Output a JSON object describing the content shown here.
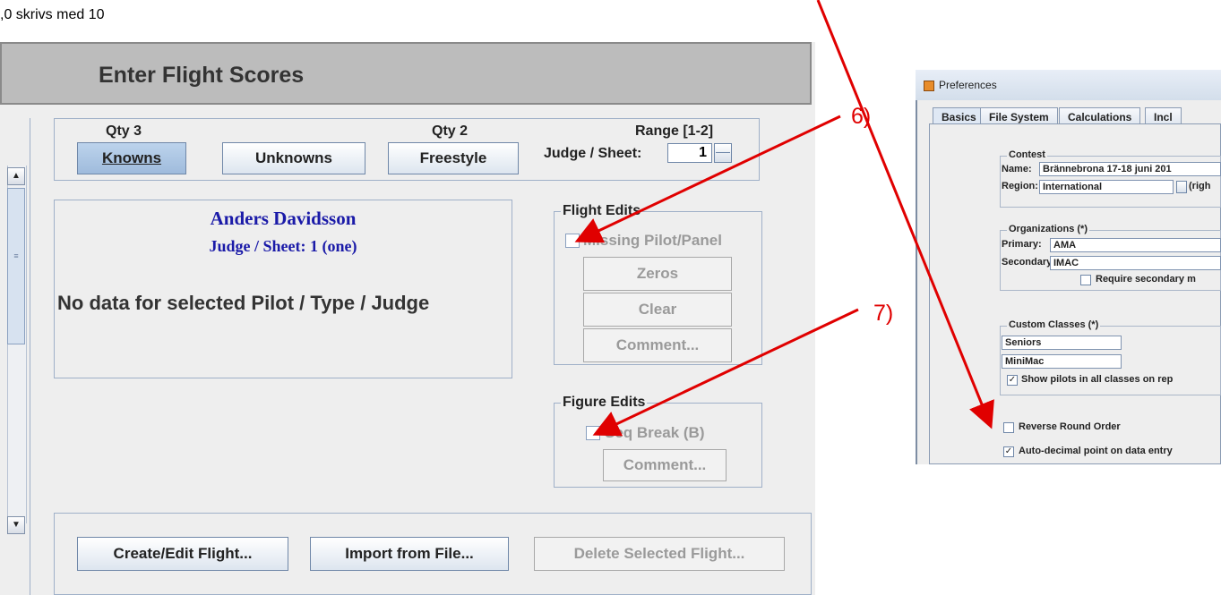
{
  "caption": ",0 skrivs med 10",
  "main": {
    "title": "Enter Flight Scores",
    "qty_knowns": "Qty 3",
    "qty_freestyle": "Qty 2",
    "range": "Range [1-2]",
    "btn_knowns": "Knowns",
    "btn_unknowns": "Unknowns",
    "btn_freestyle": "Freestyle",
    "judge_sheet_label": "Judge / Sheet:",
    "judge_sheet_value": "1",
    "pilot_name": "Anders Davidsson",
    "pilot_judge": "Judge / Sheet:  1 (one)",
    "no_data": "No data for selected Pilot / Type / Judge",
    "flight_edits_title": "Flight Edits",
    "missing_pilot": "Missing Pilot/Panel",
    "btn_zeros": "Zeros",
    "btn_clear": "Clear",
    "btn_comment_flight": "Comment...",
    "figure_edits_title": "Figure Edits",
    "seq_break": "Seq Break (B)",
    "btn_comment_figure": "Comment...",
    "btn_create": "Create/Edit Flight...",
    "btn_import": "Import from File...",
    "btn_delete": "Delete Selected Flight..."
  },
  "annotations": {
    "six": "6)",
    "seven": "7)",
    "color": "#e00000"
  },
  "preferences": {
    "title": "Preferences",
    "tabs": [
      "Basics",
      "File System",
      "Calculations",
      "Incl"
    ],
    "contest_title": "Contest",
    "name_label": "Name:",
    "name_value": "Brännebrona 17-18 juni 201",
    "region_label": "Region:",
    "region_value": "International",
    "region_hint": "(righ",
    "org_title": "Organizations (*)",
    "primary_label": "Primary:",
    "primary_value": "AMA",
    "secondary_label": "Secondary:",
    "secondary_value": "IMAC",
    "require_secondary": "Require secondary m",
    "custom_title": "Custom Classes (*)",
    "class1": "Seniors",
    "class2": "MiniMac",
    "show_pilots": "Show pilots in all classes on rep",
    "reverse_round": "Reverse Round Order",
    "auto_decimal": "Auto-decimal point on data entry"
  }
}
